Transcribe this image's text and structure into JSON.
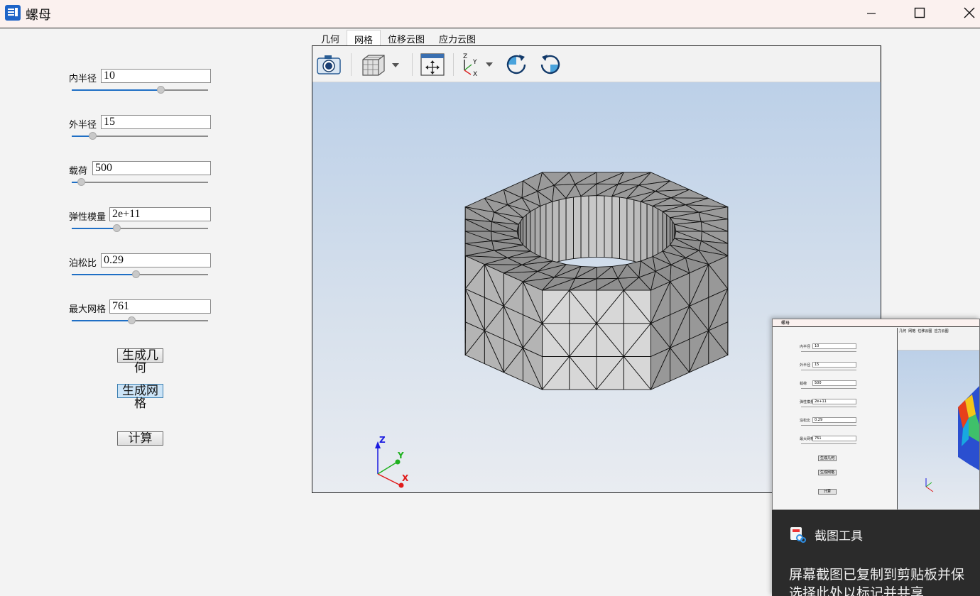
{
  "window": {
    "title": "螺母",
    "controls": [
      "minimize",
      "maximize",
      "close"
    ]
  },
  "params": [
    {
      "label": "内半径",
      "value": "10",
      "slider": 0.65
    },
    {
      "label": "外半径",
      "value": "15",
      "slider": 0.15
    },
    {
      "label": "载荷",
      "value": "500",
      "slider": 0.07
    },
    {
      "label": "弹性模量",
      "value": "2e+11",
      "slider": 0.33
    },
    {
      "label": "泊松比",
      "value": "0.29",
      "slider": 0.47
    },
    {
      "label": "最大网格",
      "value": "761",
      "slider": 0.44
    }
  ],
  "buttons": {
    "geometry": "生成几何",
    "mesh": "生成网格",
    "compute": "计算"
  },
  "tabs": [
    "几何",
    "网格",
    "位移云图",
    "应力云图"
  ],
  "active_tab": "网格",
  "toolbar": [
    "camera-icon",
    "display-mode-icon",
    "fit-all-icon",
    "view-orientation-icon",
    "rotate-right-icon",
    "rotate-left-icon"
  ],
  "axes": {
    "x": "X",
    "y": "Y",
    "z": "Z"
  },
  "notification": {
    "app": "截图工具",
    "message_line1": "屏幕截图已复制到剪贴板并保",
    "message_line2": "选择此处以标记并共享"
  },
  "thumbnail": {
    "title": "螺母",
    "tabs": [
      "几何",
      "网格",
      "位移云图",
      "应力云图"
    ]
  },
  "colors": {
    "accent": "#1f6fc5",
    "mesh_face": "#cfcfcf",
    "mesh_edge": "#111111"
  }
}
